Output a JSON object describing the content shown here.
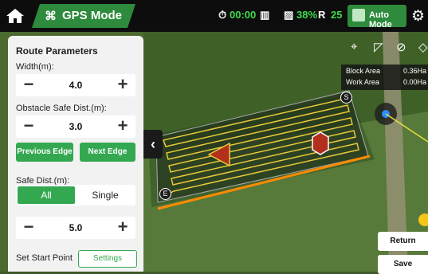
{
  "header": {
    "mode_title": "GPS Mode",
    "timer": "00:00",
    "battery1": "38%",
    "rtk": "25",
    "auto_mode": "Auto Mode"
  },
  "panel": {
    "title": "Route Parameters",
    "width_label": "Width(m):",
    "width_value": "4.0",
    "obstacle_label": "Obstacle Safe Dist.(m):",
    "obstacle_value": "3.0",
    "prev_edge": "Previous Edge",
    "next_edge": "Next Edge",
    "safe_label": "Safe Dist.(m):",
    "seg_all": "All",
    "seg_single": "Single",
    "safe_value": "5.0",
    "start_label": "Set Start Point",
    "settings_btn": "Settings"
  },
  "area": {
    "block_label": "Block Area",
    "block_value": "0.36Ha",
    "work_label": "Work Area",
    "work_value": "0.00Ha"
  },
  "map_markers": {
    "start": "S",
    "end": "E"
  },
  "actions": {
    "return": "Return",
    "save": "Save"
  }
}
